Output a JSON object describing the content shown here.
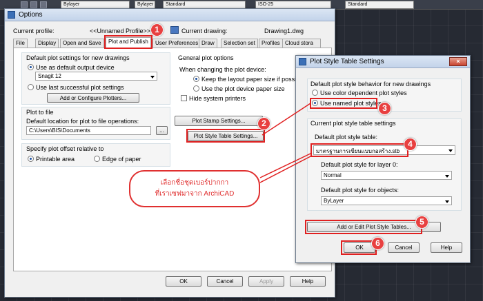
{
  "background_toolbar": {
    "combo1": "Bylayer",
    "combo2": "Bylayer",
    "combo3": "Standard",
    "combo4": "ISO-25",
    "combo5": "Standard"
  },
  "options": {
    "title": "Options",
    "current_profile_label": "Current profile:",
    "current_profile_value": "<<Unnamed Profile>>",
    "current_drawing_label": "Current drawing:",
    "current_drawing_value": "Drawing1.dwg",
    "tabs": [
      "File",
      "Display",
      "Open and Save",
      "Plot and Publish",
      "User Preferences",
      "Draw",
      "Selection set",
      "Profiles",
      "Cloud stora"
    ],
    "default_plot": {
      "heading": "Default plot settings for new drawings",
      "use_default_label": "Use as default output device",
      "device_value": "Snagit 12",
      "use_last_label": "Use last successful plot settings",
      "add_plotters_label": "Add or Configure Plotters..."
    },
    "plot_to_file": {
      "heading": "Plot to file",
      "default_location_label": "Default location for plot to file operations:",
      "path_value": "C:\\Users\\BIS\\Documents",
      "browse_label": "..."
    },
    "plot_offset": {
      "heading": "Specify plot offset relative to",
      "printable_area_label": "Printable area",
      "edge_of_paper_label": "Edge of paper"
    },
    "general": {
      "heading": "General plot options",
      "when_changing_label": "When changing the plot device:",
      "keep_layout_label": "Keep the layout paper size if possible",
      "use_device_paper_label": "Use the plot device paper size",
      "hide_printers_label": "Hide system printers"
    },
    "plot_stamp_label": "Plot Stamp Settings...",
    "plot_style_table_label": "Plot Style Table Settings...",
    "buttons": {
      "ok": "OK",
      "cancel": "Cancel",
      "apply": "Apply",
      "help": "Help"
    }
  },
  "pst": {
    "title": "Plot Style Table Settings",
    "default_behavior_heading": "Default plot style behavior for new drawings",
    "color_dependent_label": "Use color dependent plot styles",
    "named_label": "Use named plot styles",
    "current_heading": "Current plot style table settings",
    "default_table_label": "Default plot style table:",
    "default_table_value": "มาตรฐานการเขียนแบบกอสร้าง.stb",
    "layer0_label": "Default plot style for layer 0:",
    "layer0_value": "Normal",
    "objects_label": "Default plot style for objects:",
    "objects_value": "ByLayer",
    "add_edit_label": "Add or Edit Plot Style Tables...",
    "ok": "OK",
    "cancel": "Cancel",
    "help": "Help"
  },
  "callout": {
    "line1": "เลือกชื่อชุดเบอร์ปากกา",
    "line2": "ที่เราเซฟมาจาก ArchiCAD"
  },
  "steps": [
    "1",
    "2",
    "3",
    "4",
    "5",
    "6"
  ],
  "colors": {
    "annotation_red": "#e02020",
    "titlebar": "#c3d3ea",
    "badge": "#e84040"
  }
}
